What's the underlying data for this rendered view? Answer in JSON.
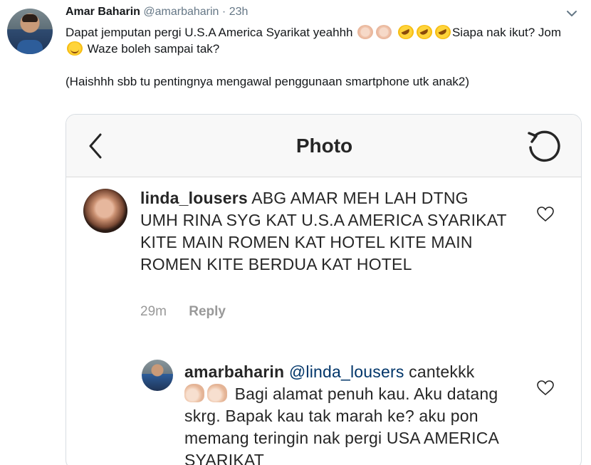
{
  "tweet": {
    "author_name": "Amar Baharin",
    "author_handle": "@amarbaharin",
    "separator": "·",
    "time": "23h",
    "text_line1_part1": "Dapat jemputan pergi U.S.A America Syarikat yeahhh ",
    "text_line1_part2": "Siapa nak ikut? Jom ",
    "text_line1_part3": " Waze boleh sampai tak?",
    "text_line2": "(Haishhh sbb tu pentingnya mengawal penggunaan smartphone utk anak2)",
    "emoji_icons": [
      "clapping-hands",
      "clapping-hands",
      "rofl",
      "rofl",
      "rofl",
      "smiling-face"
    ]
  },
  "screenshot": {
    "title": "Photo",
    "comments": [
      {
        "username": "linda_lousers",
        "text": "ABG AMAR MEH LAH DTNG UMH RINA SYG KAT U.S.A AMERICA SYARIKAT KITE MAIN ROMEN KAT HOTEL KITE MAIN ROMEN KITE BERDUA KAT HOTEL",
        "time": "29m",
        "reply_label": "Reply"
      },
      {
        "username": "amarbaharin",
        "mention": "@linda_lousers",
        "text_before_emoji": "cantekkk",
        "text": "Bagi alamat penuh kau. Aku datang skrg. Bapak kau tak marah ke? aku pon memang teringin nak pergi USA AMERICA SYARIKAT"
      }
    ]
  },
  "colors": {
    "name": "#14171a",
    "muted": "#657786",
    "ig_text": "#262626",
    "ig_meta": "#999999",
    "card_border": "#d8dde2"
  }
}
